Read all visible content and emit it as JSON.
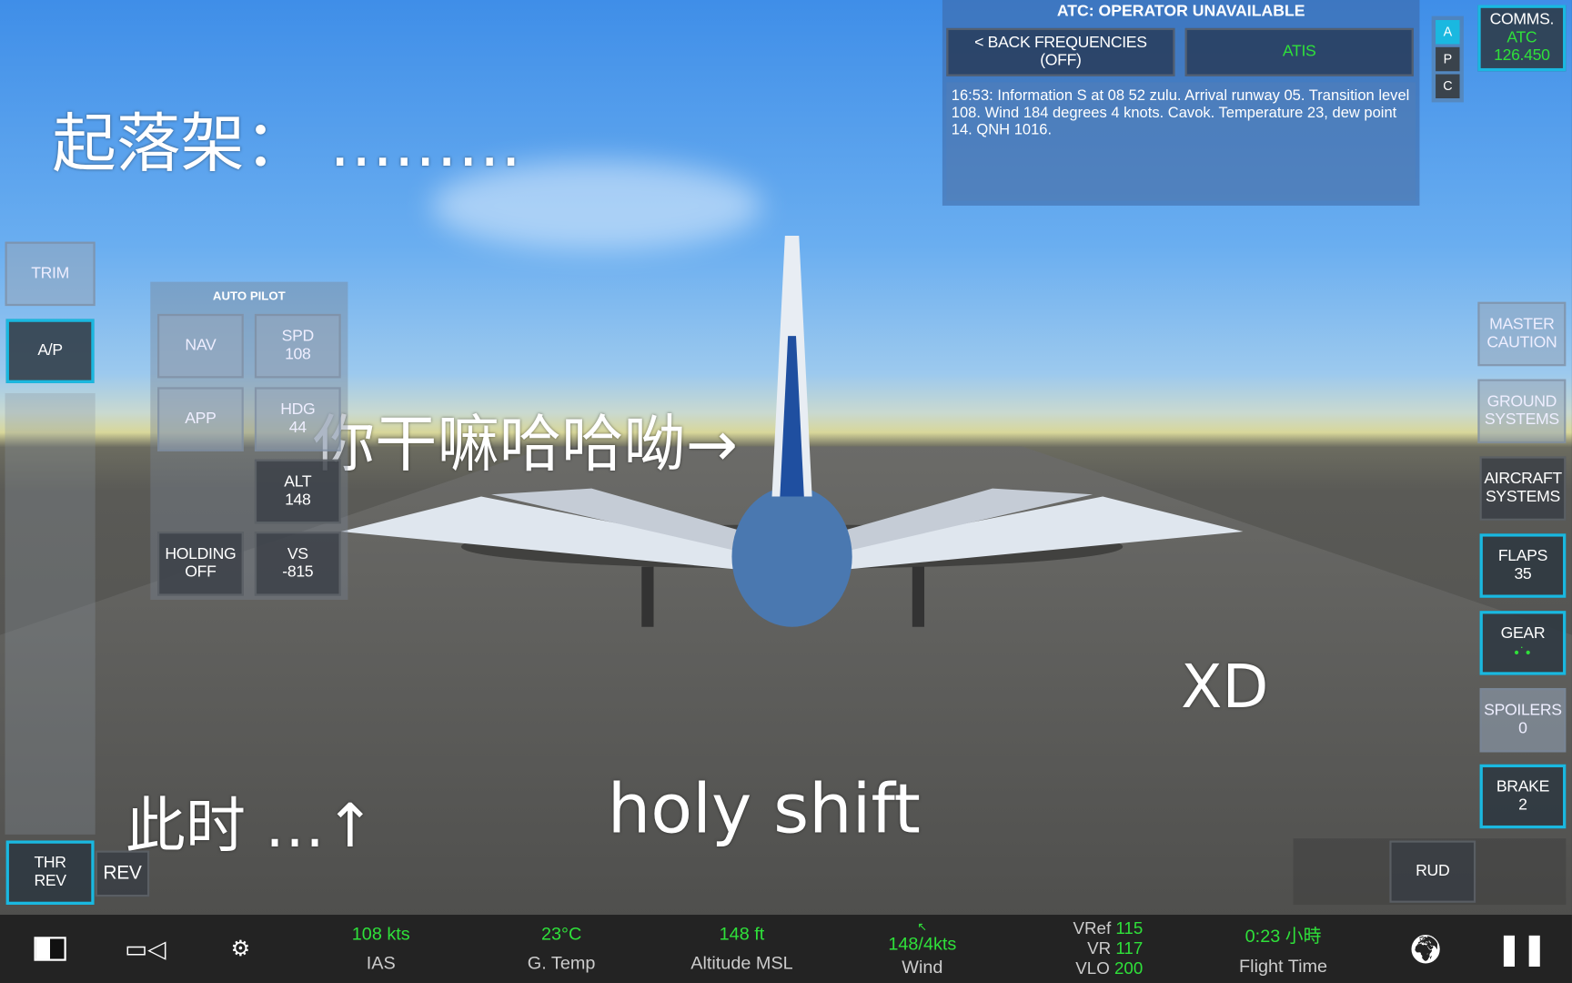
{
  "atc": {
    "title": "ATC: OPERATOR UNAVAILABLE",
    "back_label": "< BACK FREQUENCIES",
    "back_sub": "(OFF)",
    "atis_label": "ATIS",
    "message": "16:53: Information S at 08 52 zulu. Arrival runway 05. Transition level 108. Wind 184 degrees 4 knots. Cavok. Temperature 23, dew point 14. QNH 1016.",
    "tabs": [
      "A",
      "P",
      "C"
    ],
    "active_tab": "A"
  },
  "comms": {
    "label": "COMMS.",
    "mode": "ATC",
    "freq": "126.450"
  },
  "left": {
    "trim": "TRIM",
    "ap": "A/P",
    "thr_rev": "THR\nREV",
    "rev": "REV"
  },
  "autopilot": {
    "title": "AUTO PILOT",
    "nav": "NAV",
    "spd": "SPD",
    "spd_val": "108",
    "app": "APP",
    "hdg": "HDG",
    "hdg_val": "44",
    "alt": "ALT",
    "alt_val": "148",
    "holding": "HOLDING",
    "holding_val": "OFF",
    "vs": "VS",
    "vs_val": "-815"
  },
  "right": {
    "master_caution": "MASTER CAUTION",
    "ground_systems": "GROUND SYSTEMS",
    "aircraft_systems": "AIRCRAFT SYSTEMS",
    "flaps": "FLAPS",
    "flaps_val": "35",
    "gear": "GEAR",
    "spoilers": "SPOILERS",
    "spoilers_val": "0",
    "brake": "BRAKE",
    "brake_val": "2",
    "rud": "RUD"
  },
  "bottom": {
    "ias_val": "108 kts",
    "ias": "IAS",
    "temp_val": "23°C",
    "temp": "G. Temp",
    "alt_val": "148 ft",
    "alt": "Altitude MSL",
    "wind_val": "148/4kts",
    "wind": "Wind",
    "vref": "VRef",
    "vref_val": "115",
    "vr": "VR",
    "vr_val": "117",
    "vlo": "VLO",
    "vlo_val": "200",
    "time_val": "0:23 小時",
    "time": "Flight Time"
  },
  "captions": {
    "gear": "起落架：  ………",
    "what": "你干嘛哈哈呦→",
    "xd": "XD",
    "now": "此时 …↑",
    "holy": "holy shift"
  },
  "colors": {
    "accent": "#1ab8e0",
    "value_green": "#2fe03a"
  }
}
